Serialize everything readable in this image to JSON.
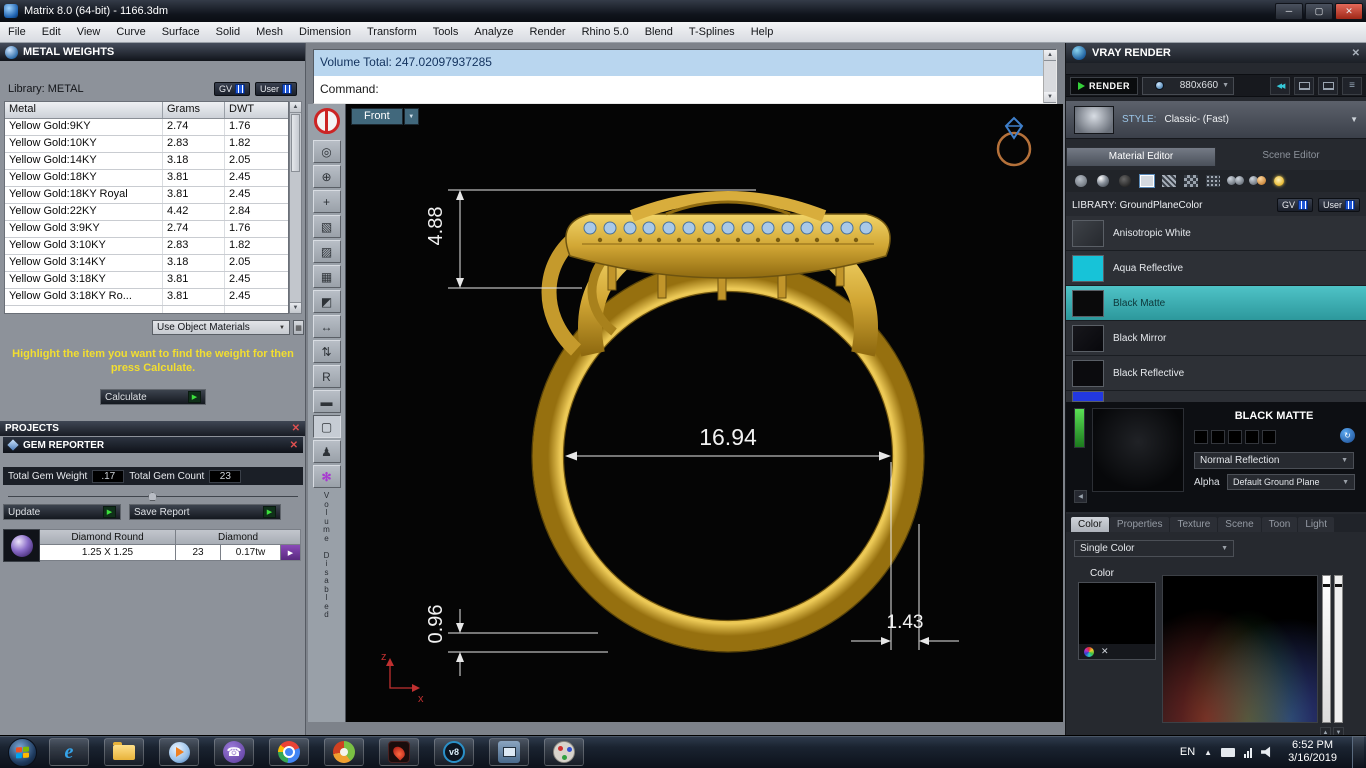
{
  "titlebar": {
    "title": "Matrix 8.0 (64-bit) - 1166.3dm"
  },
  "icons": {
    "minimize": "─",
    "maximize": "▢",
    "close": "✕",
    "dropdown": "▼",
    "play": "▶",
    "up": "▲",
    "down": "▼",
    "left": "◀",
    "right": "▶",
    "rewind": "◀◀",
    "menu": "≡",
    "refresh": "↻",
    "grid": "▦"
  },
  "menubar": {
    "items": [
      "File",
      "Edit",
      "View",
      "Curve",
      "Surface",
      "Solid",
      "Mesh",
      "Dimension",
      "Transform",
      "Tools",
      "Analyze",
      "Render",
      "Rhino 5.0",
      "Blend",
      "T-Splines",
      "Help"
    ]
  },
  "metal_weights": {
    "title": "METAL WEIGHTS",
    "library_label": "Library: METAL",
    "gv_button": "GV",
    "user_button": "User",
    "columns": [
      "Metal",
      "Grams",
      "DWT"
    ],
    "rows": [
      [
        "Yellow Gold:9KY",
        "2.74",
        "1.76"
      ],
      [
        "Yellow Gold:10KY",
        "2.83",
        "1.82"
      ],
      [
        "Yellow Gold:14KY",
        "3.18",
        "2.05"
      ],
      [
        "Yellow Gold:18KY",
        "3.81",
        "2.45"
      ],
      [
        "Yellow Gold:18KY Royal",
        "3.81",
        "2.45"
      ],
      [
        "Yellow Gold:22KY",
        "4.42",
        "2.84"
      ],
      [
        "Yellow Gold 3:9KY",
        "2.74",
        "1.76"
      ],
      [
        "Yellow Gold 3:10KY",
        "2.83",
        "1.82"
      ],
      [
        "Yellow Gold 3:14KY",
        "3.18",
        "2.05"
      ],
      [
        "Yellow Gold 3:18KY",
        "3.81",
        "2.45"
      ],
      [
        "Yellow Gold 3:18KY Ro...",
        "3.81",
        "2.45"
      ]
    ],
    "use_object_materials": "Use Object Materials",
    "instruction": "Highlight the item you want to find the weight for then press Calculate.",
    "calculate_button": "Calculate"
  },
  "projects": {
    "title": "PROJECTS"
  },
  "gem_reporter": {
    "title": "GEM REPORTER",
    "weight_label": "Total Gem Weight",
    "weight_value": ".17",
    "count_label": "Total Gem Count",
    "count_value": "23",
    "update_button": "Update",
    "save_button": "Save Report",
    "gem_name": "Diamond Round",
    "gem_type": "Diamond",
    "gem_size": "1.25 X 1.25",
    "gem_count": "23",
    "gem_weight": "0.17tw"
  },
  "command": {
    "history": "Volume Total: 247.02097937285",
    "prompt": "Command:"
  },
  "viewport": {
    "view_name": "Front",
    "toolbar_glyphs": [
      "◎",
      "⊕",
      "+",
      "▧",
      "▨",
      "▦",
      "◩",
      "↔",
      "⇅",
      "R",
      "▬",
      "▢",
      "♟",
      "✻"
    ],
    "dim_head_height": "4.88",
    "dim_diameter": "16.94",
    "dim_bottom": "0.96",
    "dim_side": "1.43",
    "axis_z": "z",
    "axis_x": "x",
    "volume_disabled": "V\no\nl\nu\nm\ne\n\nD\ni\ns\na\nb\nl\ne\nd"
  },
  "vray": {
    "title": "VRAY RENDER",
    "render_button": "RENDER",
    "resolution": "880x660",
    "style_label": "STYLE:",
    "style_value": "Classic- (Fast)",
    "tab_material": "Material Editor",
    "tab_scene": "Scene Editor",
    "library_label": "LIBRARY: GroundPlaneColor",
    "gv_button": "GV",
    "user_button": "User",
    "materials": [
      "Anisotropic White",
      "Aqua Reflective",
      "Black Matte",
      "Black Mirror",
      "Black Reflective"
    ],
    "selected_material": "Black Matte",
    "preview_title": "BLACK MATTE",
    "reflection": "Normal Reflection",
    "alpha_label": "Alpha",
    "ground_plane": "Default Ground Plane",
    "tabs": [
      "Color",
      "Properties",
      "Texture",
      "Scene",
      "Toon",
      "Light"
    ],
    "color_mode": "Single Color",
    "color_label": "Color",
    "aqua_swatch_color": "#17c3d8",
    "selection_teal": "#3db4b8"
  },
  "taskbar": {
    "language": "EN",
    "time": "6:52 PM",
    "date": "3/16/2019"
  },
  "colors": {
    "gold": "#d2a735",
    "selection_blue": "#b9d6ef",
    "highlight_yellow": "#f2de30",
    "gem_blue": "#a9c9e8"
  }
}
